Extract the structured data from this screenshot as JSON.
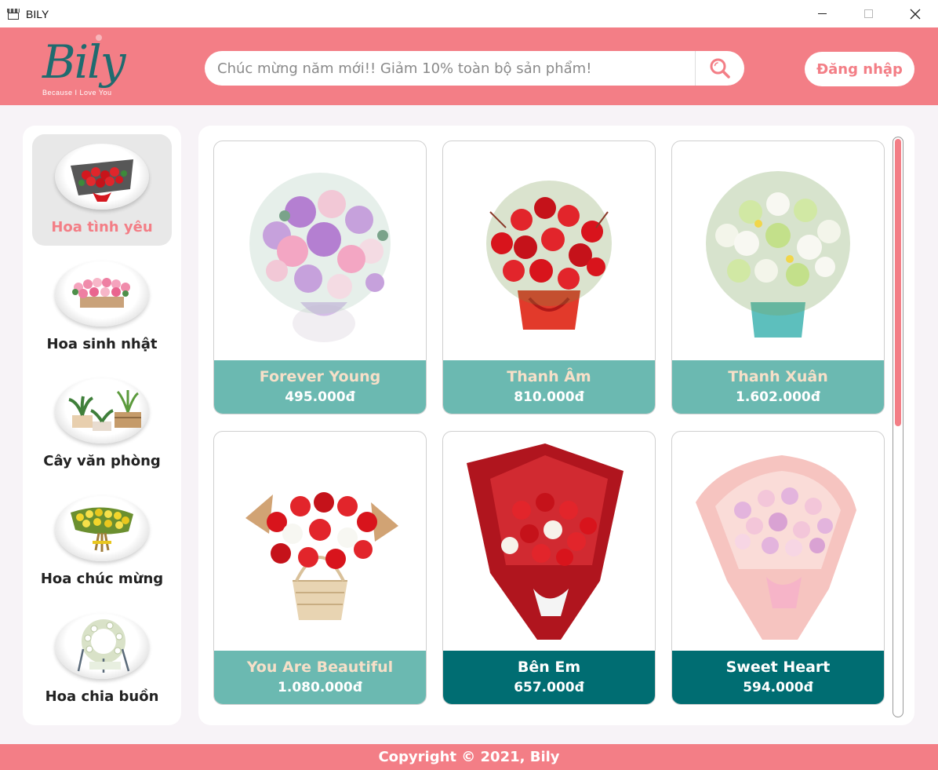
{
  "window": {
    "title": "BILY",
    "icon": "store-icon",
    "controls": [
      "minimize-icon",
      "maximize-icon",
      "close-icon"
    ]
  },
  "header": {
    "logo_text": "Bily",
    "logo_tagline": "Because I Love You",
    "search": {
      "value": "",
      "placeholder": "Chúc mừng năm mới!! Giảm 10% toàn bộ sản phẩm!",
      "button_icon": "search-icon"
    },
    "login_label": "Đăng nhập"
  },
  "sidebar": {
    "items": [
      {
        "label": "Hoa tình yêu",
        "active": true,
        "icon": "love-bouquet-icon"
      },
      {
        "label": "Hoa sinh nhật",
        "active": false,
        "icon": "birthday-flowers-icon"
      },
      {
        "label": "Cây văn phòng",
        "active": false,
        "icon": "office-plant-icon"
      },
      {
        "label": "Hoa chúc mừng",
        "active": false,
        "icon": "congrats-flowers-icon"
      },
      {
        "label": "Hoa chia buồn",
        "active": false,
        "icon": "condolence-wreath-icon"
      }
    ]
  },
  "products": [
    {
      "name": "Forever Young",
      "price": "495.000đ",
      "style": "light"
    },
    {
      "name": "Thanh Âm",
      "price": "810.000đ",
      "style": "light"
    },
    {
      "name": "Thanh Xuân",
      "price": "1.602.000đ",
      "style": "light"
    },
    {
      "name": "You Are Beautiful",
      "price": "1.080.000đ",
      "style": "light"
    },
    {
      "name": "Bên Em",
      "price": "657.000đ",
      "style": "dark"
    },
    {
      "name": "Sweet Heart",
      "price": "594.000đ",
      "style": "dark"
    }
  ],
  "footer": {
    "text": "Copyright © 2021, Bily"
  },
  "colors": {
    "brand_pink": "#f37e86",
    "teal_light": "#6bb9b1",
    "teal_dark": "#006d72",
    "logo_teal": "#1f6b6f",
    "background": "#f7f3f7"
  },
  "scroll": {
    "position_fraction": 0.0,
    "visible_fraction": 0.5
  }
}
